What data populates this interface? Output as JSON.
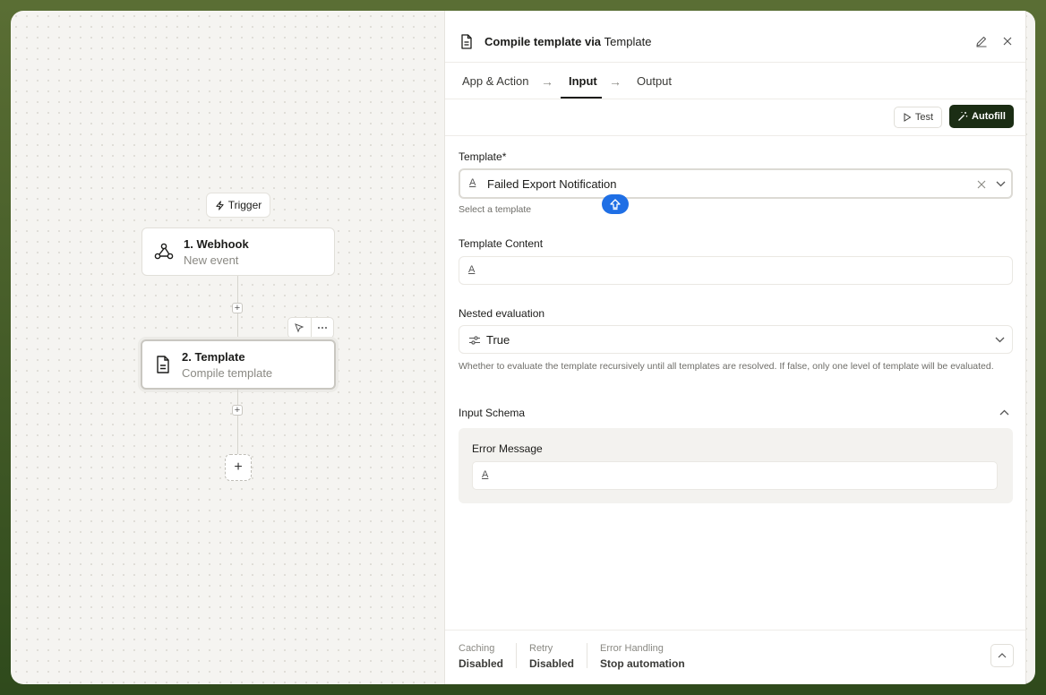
{
  "canvas": {
    "trigger_label": "Trigger",
    "nodes": [
      {
        "title": "1. Webhook",
        "subtitle": "New event"
      },
      {
        "title": "2. Template",
        "subtitle": "Compile template"
      }
    ],
    "add_symbol": "+"
  },
  "panel": {
    "title_action": "Compile template via",
    "title_app": "Template",
    "tabs": [
      {
        "label": "App & Action"
      },
      {
        "label": "Input"
      },
      {
        "label": "Output"
      }
    ],
    "arrow_glyph": "→",
    "test_label": "Test",
    "autofill_label": "Autofill",
    "template": {
      "label": "Template*",
      "value": "Failed Export Notification",
      "hint": "Select a template"
    },
    "template_content": {
      "label": "Template Content",
      "value": ""
    },
    "nested": {
      "label": "Nested evaluation",
      "value": "True",
      "hint": "Whether to evaluate the template recursively until all templates are resolved. If false, only one level of template will be evaluated."
    },
    "input_schema": {
      "label": "Input Schema",
      "fields": [
        {
          "label": "Error Message",
          "value": ""
        }
      ]
    },
    "footer": {
      "caching": {
        "label": "Caching",
        "value": "Disabled"
      },
      "retry": {
        "label": "Retry",
        "value": "Disabled"
      },
      "error_handling": {
        "label": "Error Handling",
        "value": "Stop automation"
      }
    }
  },
  "colors": {
    "accent_dark": "#1b2d14",
    "badge_blue": "#1f6fe5"
  }
}
